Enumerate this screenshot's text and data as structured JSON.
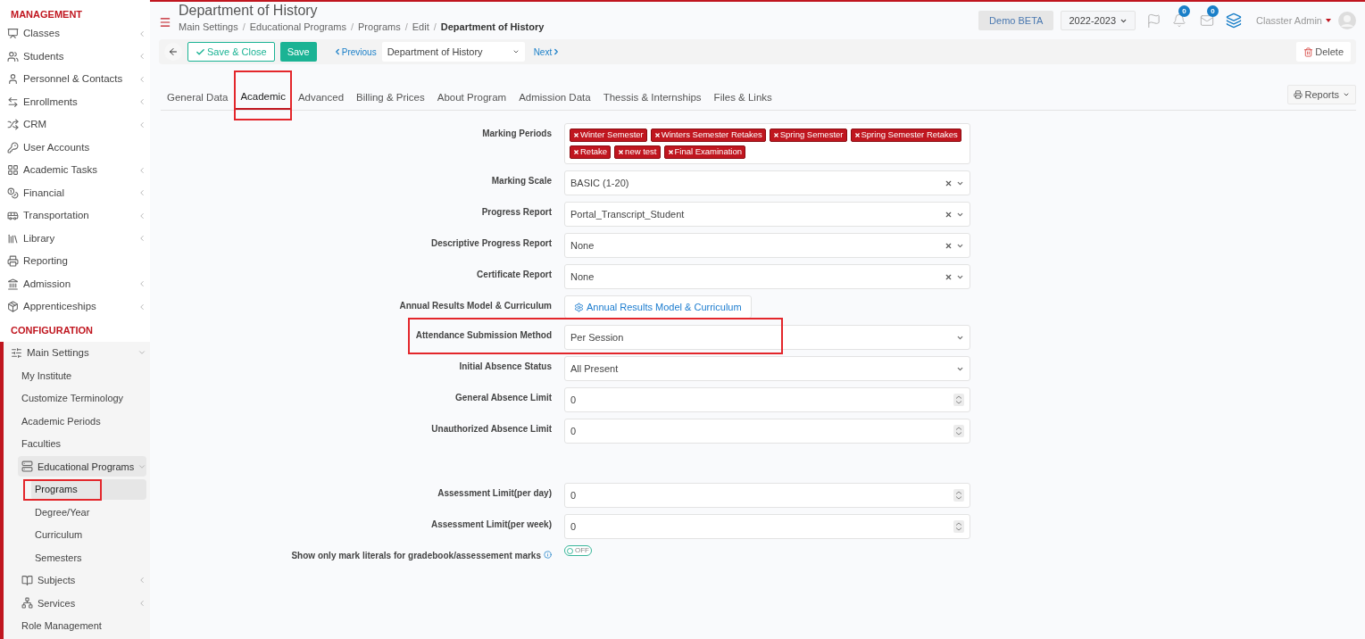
{
  "sidebar": {
    "sections": [
      {
        "title": "MANAGEMENT",
        "items": [
          {
            "label": "Classes",
            "has_submenu": true,
            "expanded": false,
            "selected": false,
            "highlighted": false
          },
          {
            "label": "Students",
            "has_submenu": true,
            "expanded": false,
            "selected": false,
            "highlighted": false
          },
          {
            "label": "Personnel & Contacts",
            "has_submenu": true,
            "expanded": false,
            "selected": false,
            "highlighted": false
          },
          {
            "label": "Enrollments",
            "has_submenu": true,
            "expanded": false,
            "selected": false,
            "highlighted": false
          },
          {
            "label": "CRM",
            "has_submenu": true,
            "expanded": false,
            "selected": false,
            "highlighted": false
          },
          {
            "label": "User Accounts",
            "has_submenu": false,
            "expanded": false,
            "selected": false,
            "highlighted": false
          },
          {
            "label": "Academic Tasks",
            "has_submenu": true,
            "expanded": false,
            "selected": false,
            "highlighted": false
          },
          {
            "label": "Financial",
            "has_submenu": true,
            "expanded": false,
            "selected": false,
            "highlighted": false
          },
          {
            "label": "Transportation",
            "has_submenu": true,
            "expanded": false,
            "selected": false,
            "highlighted": false
          },
          {
            "label": "Library",
            "has_submenu": true,
            "expanded": false,
            "selected": false,
            "highlighted": false
          },
          {
            "label": "Reporting",
            "has_submenu": false,
            "expanded": false,
            "selected": false,
            "highlighted": false
          },
          {
            "label": "Admission",
            "has_submenu": true,
            "expanded": false,
            "selected": false,
            "highlighted": false
          },
          {
            "label": "Apprenticeships",
            "has_submenu": true,
            "expanded": false,
            "selected": false,
            "highlighted": false
          }
        ]
      },
      {
        "title": "CONFIGURATION",
        "items": [
          {
            "label": "Main Settings",
            "has_submenu": true,
            "expanded": true,
            "selected": false,
            "highlighted": false,
            "children": [
              {
                "label": "My Institute",
                "has_submenu": false,
                "expanded": false,
                "selected": false,
                "highlighted": false
              },
              {
                "label": "Customize Terminology",
                "has_submenu": false,
                "expanded": false,
                "selected": false,
                "highlighted": false
              },
              {
                "label": "Academic Periods",
                "has_submenu": false,
                "expanded": false,
                "selected": false,
                "highlighted": false
              },
              {
                "label": "Faculties",
                "has_submenu": false,
                "expanded": false,
                "selected": false,
                "highlighted": false
              },
              {
                "label": "Educational Programs",
                "has_submenu": true,
                "expanded": true,
                "selected": false,
                "highlighted": false,
                "children": [
                  {
                    "label": "Programs",
                    "has_submenu": false,
                    "expanded": false,
                    "selected": true,
                    "highlighted": true
                  },
                  {
                    "label": "Degree/Year",
                    "has_submenu": false,
                    "expanded": false,
                    "selected": false,
                    "highlighted": false
                  },
                  {
                    "label": "Curriculum",
                    "has_submenu": false,
                    "expanded": false,
                    "selected": false,
                    "highlighted": false
                  },
                  {
                    "label": "Semesters",
                    "has_submenu": false,
                    "expanded": false,
                    "selected": false,
                    "highlighted": false
                  }
                ]
              },
              {
                "label": "Subjects",
                "has_submenu": true,
                "expanded": false,
                "selected": false,
                "highlighted": false
              },
              {
                "label": "Services",
                "has_submenu": true,
                "expanded": false,
                "selected": false,
                "highlighted": false
              },
              {
                "label": "Role Management",
                "has_submenu": false,
                "expanded": false,
                "selected": false,
                "highlighted": false
              }
            ]
          }
        ]
      }
    ]
  },
  "header": {
    "title": "Department of History",
    "separator": "/",
    "breadcrumb": [
      "Main Settings",
      "Educational Programs",
      "Programs",
      "Edit",
      "Department of History"
    ],
    "environment": "Demo BETA",
    "year": "2022-2023",
    "notifications": "0",
    "messages": "0",
    "user": "Classter Admin"
  },
  "toolbar": {
    "save_close": "Save & Close",
    "save": "Save",
    "previous": "Previous",
    "record": "Department of History",
    "next": "Next",
    "delete": "Delete"
  },
  "tabs": [
    {
      "label": "General Data",
      "selected": false,
      "highlighted": false
    },
    {
      "label": "Academic",
      "selected": true,
      "highlighted": true
    },
    {
      "label": "Advanced",
      "selected": false,
      "highlighted": false
    },
    {
      "label": "Billing & Prices",
      "selected": false,
      "highlighted": false
    },
    {
      "label": "About Program",
      "selected": false,
      "highlighted": false
    },
    {
      "label": "Admission Data",
      "selected": false,
      "highlighted": false
    },
    {
      "label": "Thessis & Internships",
      "selected": false,
      "highlighted": false
    },
    {
      "label": "Files & Links",
      "selected": false,
      "highlighted": false
    }
  ],
  "reports": "Reports",
  "form": [
    {
      "kind": "tags",
      "label": "Marking Periods",
      "highlighted": false,
      "tags": [
        "Winter Semester",
        "Winters Semester Retakes",
        "Spring Semester",
        "Spring Semester Retakes",
        "Retake",
        "new test",
        "Final Examination"
      ]
    },
    {
      "kind": "select",
      "label": "Marking Scale",
      "highlighted": false,
      "value": "BASIC (1-20)",
      "clearable": true
    },
    {
      "kind": "select",
      "label": "Progress Report",
      "highlighted": false,
      "value": "Portal_Transcript_Student",
      "clearable": true
    },
    {
      "kind": "select",
      "label": "Descriptive Progress Report",
      "highlighted": false,
      "value": "None",
      "clearable": true
    },
    {
      "kind": "select",
      "label": "Certificate Report",
      "highlighted": false,
      "value": "None",
      "clearable": true
    },
    {
      "kind": "button",
      "label": "Annual Results Model & Curriculum",
      "highlighted": false,
      "value": "Annual Results Model & Curriculum"
    },
    {
      "kind": "select",
      "label": "Attendance Submission Method",
      "highlighted": true,
      "value": "Per Session",
      "clearable": false
    },
    {
      "kind": "select",
      "label": "Initial Absence Status",
      "highlighted": false,
      "value": "All Present",
      "clearable": false
    },
    {
      "kind": "number",
      "label": "General Absence Limit",
      "highlighted": false,
      "value": "0"
    },
    {
      "kind": "number",
      "label": "Unauthorized Absence Limit",
      "highlighted": false,
      "value": "0"
    },
    {
      "kind": "spacer"
    },
    {
      "kind": "number",
      "label": "Assessment Limit(per day)",
      "highlighted": false,
      "value": "0"
    },
    {
      "kind": "number",
      "label": "Assessment Limit(per week)",
      "highlighted": false,
      "value": "0"
    },
    {
      "kind": "toggle",
      "label": "Show only mark literals for gradebook/assessement marks",
      "highlighted": false,
      "on": false,
      "state_label": "OFF"
    }
  ]
}
